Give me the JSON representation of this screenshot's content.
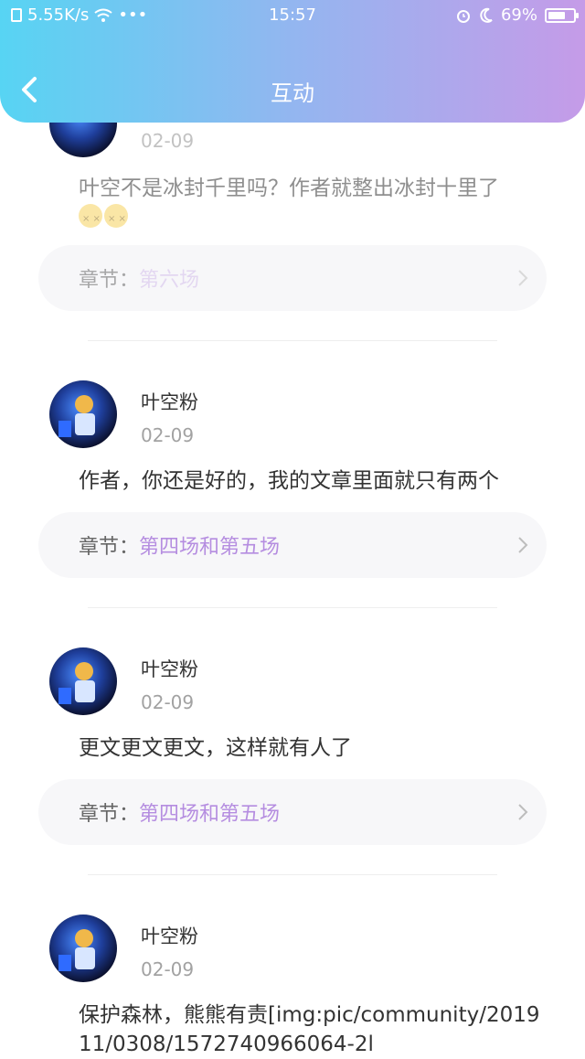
{
  "status": {
    "net_speed": "5.55K/s",
    "dots": "•••",
    "time": "15:57",
    "battery": "69%",
    "battery_level": 0.69
  },
  "header": {
    "title": "互动"
  },
  "comments": [
    {
      "date": "02-09",
      "content": "叶空不是冰封千里吗？作者就整出冰封十里了",
      "chapter_label": "章节：",
      "chapter_name": "第六场"
    },
    {
      "username": "叶空粉",
      "date": "02-09",
      "content": "作者，你还是好的，我的文章里面就只有两个",
      "chapter_label": "章节：",
      "chapter_name": "第四场和第五场"
    },
    {
      "username": "叶空粉",
      "date": "02-09",
      "content": "更文更文更文，这样就有人了",
      "chapter_label": "章节：",
      "chapter_name": "第四场和第五场"
    },
    {
      "username": "叶空粉",
      "date": "02-09",
      "content": "保护森林，熊熊有责[img:pic/community/201911/0308/1572740966064-2l"
    }
  ],
  "colors": {
    "header_start": "#57d4f3",
    "header_end": "#c59be8",
    "chapter_accent": "#b58de0"
  }
}
